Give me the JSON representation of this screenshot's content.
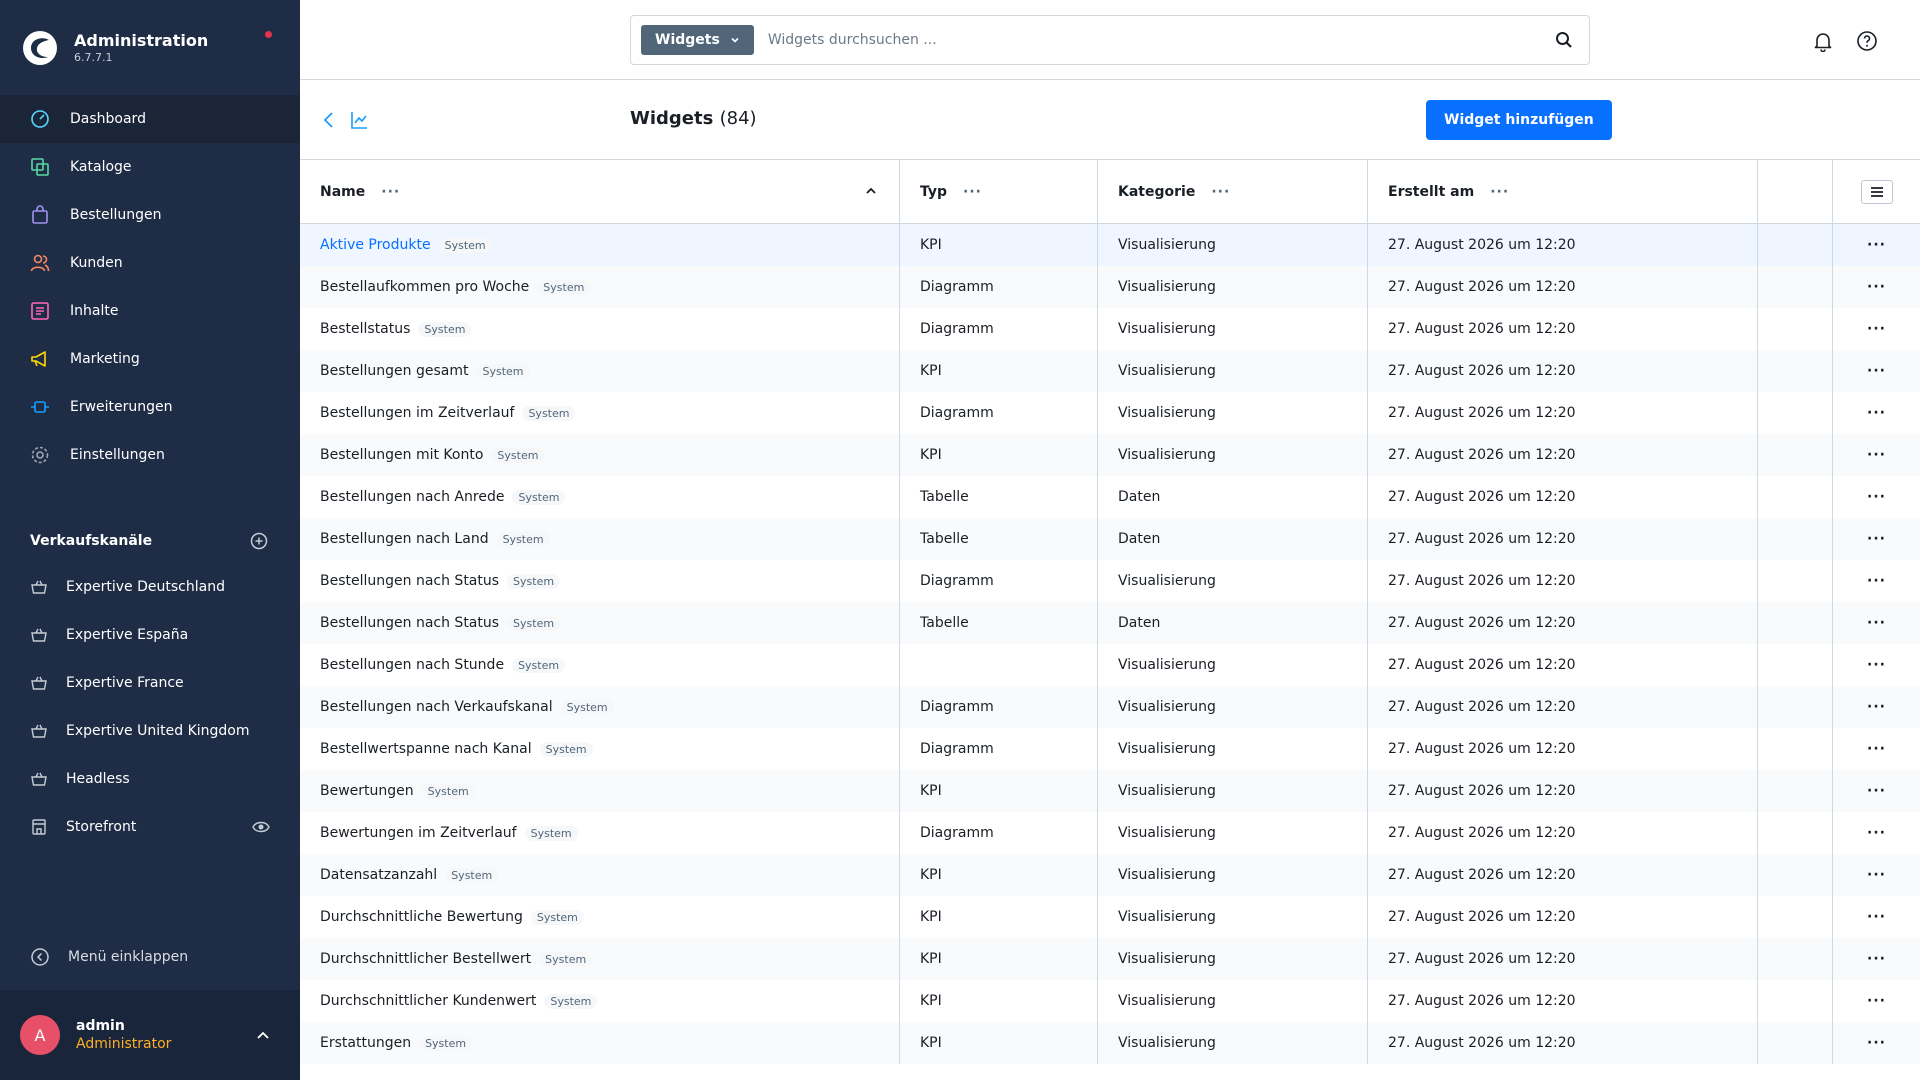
{
  "app": {
    "title": "Administration",
    "version": "6.7.7.1"
  },
  "colors": {
    "sidebar": "#1e2d45",
    "primary": "#0870ff",
    "notification_dot": "#e3334d",
    "role": "#ffb024"
  },
  "nav": [
    {
      "label": "Dashboard",
      "icon": "dashboard-icon",
      "color": "#57d9ff"
    },
    {
      "label": "Kataloge",
      "icon": "catalog-icon",
      "color": "#57d9a3"
    },
    {
      "label": "Bestellungen",
      "icon": "orders-icon",
      "color": "#a092f0"
    },
    {
      "label": "Kunden",
      "icon": "customers-icon",
      "color": "#f88962"
    },
    {
      "label": "Inhalte",
      "icon": "content-icon",
      "color": "#ff68b4"
    },
    {
      "label": "Marketing",
      "icon": "marketing-icon",
      "color": "#ffd700"
    },
    {
      "label": "Erweiterungen",
      "icon": "extensions-icon",
      "color": "#189eff"
    },
    {
      "label": "Einstellungen",
      "icon": "settings-icon",
      "color": "#9aa8b5"
    }
  ],
  "channels": {
    "heading": "Verkaufskanäle",
    "items": [
      {
        "label": "Expertive Deutschland"
      },
      {
        "label": "Expertive España"
      },
      {
        "label": "Expertive France"
      },
      {
        "label": "Expertive United Kingdom"
      },
      {
        "label": "Headless"
      },
      {
        "label": "Storefront"
      }
    ]
  },
  "collapse_label": "Menü einklappen",
  "user": {
    "initial": "A",
    "name": "admin",
    "role": "Administrator"
  },
  "search": {
    "type": "Widgets",
    "placeholder": "Widgets durchsuchen ..."
  },
  "page": {
    "title": "Widgets",
    "count": "(84)",
    "add_button": "Widget hinzufügen"
  },
  "columns": {
    "name": "Name",
    "typ": "Typ",
    "kategorie": "Kategorie",
    "erstellt": "Erstellt am",
    "more": "···"
  },
  "rows": [
    {
      "name": "Aktive Produkte",
      "badge": "System",
      "typ": "KPI",
      "kategorie": "Visualisierung",
      "date": "27. August 2026 um 12:20"
    },
    {
      "name": "Bestellaufkommen pro Woche",
      "badge": "System",
      "typ": "Diagramm",
      "kategorie": "Visualisierung",
      "date": "27. August 2026 um 12:20"
    },
    {
      "name": "Bestellstatus",
      "badge": "System",
      "typ": "Diagramm",
      "kategorie": "Visualisierung",
      "date": "27. August 2026 um 12:20"
    },
    {
      "name": "Bestellungen gesamt",
      "badge": "System",
      "typ": "KPI",
      "kategorie": "Visualisierung",
      "date": "27. August 2026 um 12:20"
    },
    {
      "name": "Bestellungen im Zeitverlauf",
      "badge": "System",
      "typ": "Diagramm",
      "kategorie": "Visualisierung",
      "date": "27. August 2026 um 12:20"
    },
    {
      "name": "Bestellungen mit Konto",
      "badge": "System",
      "typ": "KPI",
      "kategorie": "Visualisierung",
      "date": "27. August 2026 um 12:20"
    },
    {
      "name": "Bestellungen nach Anrede",
      "badge": "System",
      "typ": "Tabelle",
      "kategorie": "Daten",
      "date": "27. August 2026 um 12:20"
    },
    {
      "name": "Bestellungen nach Land",
      "badge": "System",
      "typ": "Tabelle",
      "kategorie": "Daten",
      "date": "27. August 2026 um 12:20"
    },
    {
      "name": "Bestellungen nach Status",
      "badge": "System",
      "typ": "Diagramm",
      "kategorie": "Visualisierung",
      "date": "27. August 2026 um 12:20"
    },
    {
      "name": "Bestellungen nach Status",
      "badge": "System",
      "typ": "Tabelle",
      "kategorie": "Daten",
      "date": "27. August 2026 um 12:20"
    },
    {
      "name": "Bestellungen nach Stunde",
      "badge": "System",
      "typ": "",
      "kategorie": "Visualisierung",
      "date": "27. August 2026 um 12:20"
    },
    {
      "name": "Bestellungen nach Verkaufskanal",
      "badge": "System",
      "typ": "Diagramm",
      "kategorie": "Visualisierung",
      "date": "27. August 2026 um 12:20"
    },
    {
      "name": "Bestellwertspanne nach Kanal",
      "badge": "System",
      "typ": "Diagramm",
      "kategorie": "Visualisierung",
      "date": "27. August 2026 um 12:20"
    },
    {
      "name": "Bewertungen",
      "badge": "System",
      "typ": "KPI",
      "kategorie": "Visualisierung",
      "date": "27. August 2026 um 12:20"
    },
    {
      "name": "Bewertungen im Zeitverlauf",
      "badge": "System",
      "typ": "Diagramm",
      "kategorie": "Visualisierung",
      "date": "27. August 2026 um 12:20"
    },
    {
      "name": "Datensatzanzahl",
      "badge": "System",
      "typ": "KPI",
      "kategorie": "Visualisierung",
      "date": "27. August 2026 um 12:20"
    },
    {
      "name": "Durchschnittliche Bewertung",
      "badge": "System",
      "typ": "KPI",
      "kategorie": "Visualisierung",
      "date": "27. August 2026 um 12:20"
    },
    {
      "name": "Durchschnittlicher Bestellwert",
      "badge": "System",
      "typ": "KPI",
      "kategorie": "Visualisierung",
      "date": "27. August 2026 um 12:20"
    },
    {
      "name": "Durchschnittlicher Kundenwert",
      "badge": "System",
      "typ": "KPI",
      "kategorie": "Visualisierung",
      "date": "27. August 2026 um 12:20"
    },
    {
      "name": "Erstattungen",
      "badge": "System",
      "typ": "KPI",
      "kategorie": "Visualisierung",
      "date": "27. August 2026 um 12:20"
    }
  ]
}
